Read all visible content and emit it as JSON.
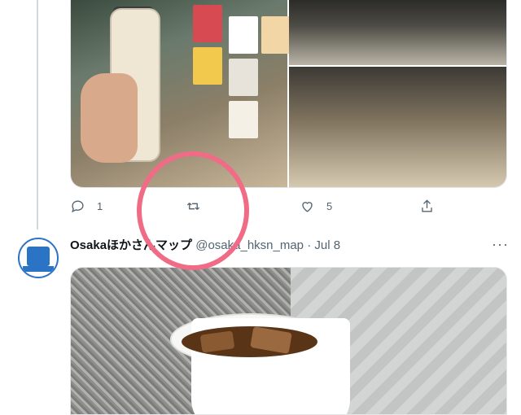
{
  "tweet1": {
    "media_alt": "Photos of a NOU bottle and a coffee shop counter",
    "actions": {
      "reply_count": "1",
      "like_count": "5",
      "retweet_count": "",
      "share_count": ""
    }
  },
  "tweet2": {
    "display_name": "Osakaほかさんマップ",
    "handle": "@osaka_hksn_map",
    "separator": "·",
    "date": "Jul 8",
    "more": "···"
  },
  "annotation": {
    "color": "#f06c86"
  }
}
